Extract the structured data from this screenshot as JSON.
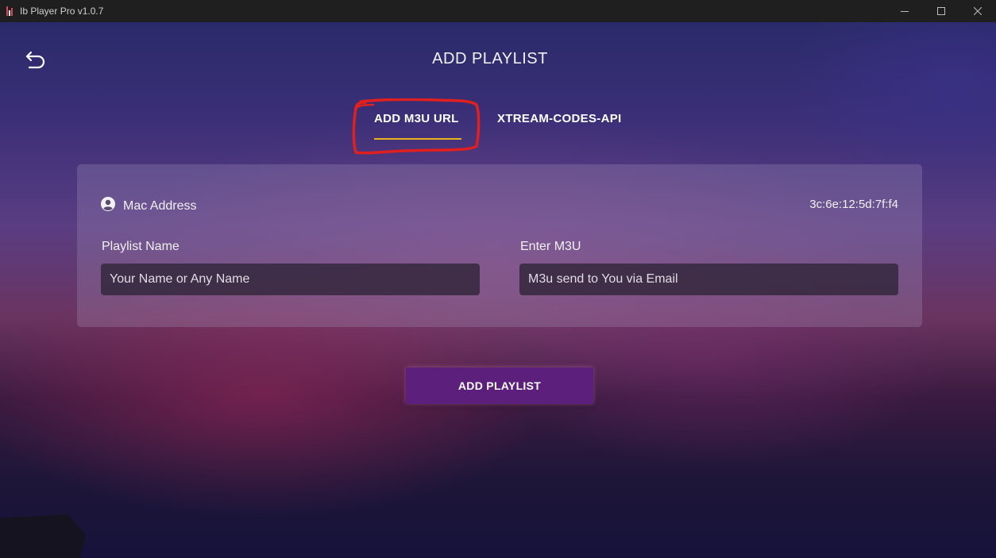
{
  "window": {
    "title": "Ib Player Pro v1.0.7",
    "controls": {
      "minimize": "minimize-icon",
      "maximize": "maximize-icon",
      "close": "close-icon"
    }
  },
  "header": {
    "back_icon": "back-arrow-icon",
    "title": "ADD PLAYLIST"
  },
  "tabs": [
    {
      "label": "ADD M3U URL",
      "active": true
    },
    {
      "label": "XTREAM-CODES-API",
      "active": false
    }
  ],
  "form": {
    "mac_label": "Mac Address",
    "mac_icon": "user-circle-icon",
    "mac_value": "3c:6e:12:5d:7f:f4",
    "playlist_name_label": "Playlist Name",
    "playlist_name_placeholder": "Your Name or Any Name",
    "m3u_label": "Enter M3U",
    "m3u_placeholder": "M3u send to You via Email"
  },
  "actions": {
    "add_label": "ADD PLAYLIST"
  },
  "colors": {
    "tab_underline": "#e8b21a",
    "button_bg": "#5c1f7c",
    "annotation": "#e0201e"
  }
}
